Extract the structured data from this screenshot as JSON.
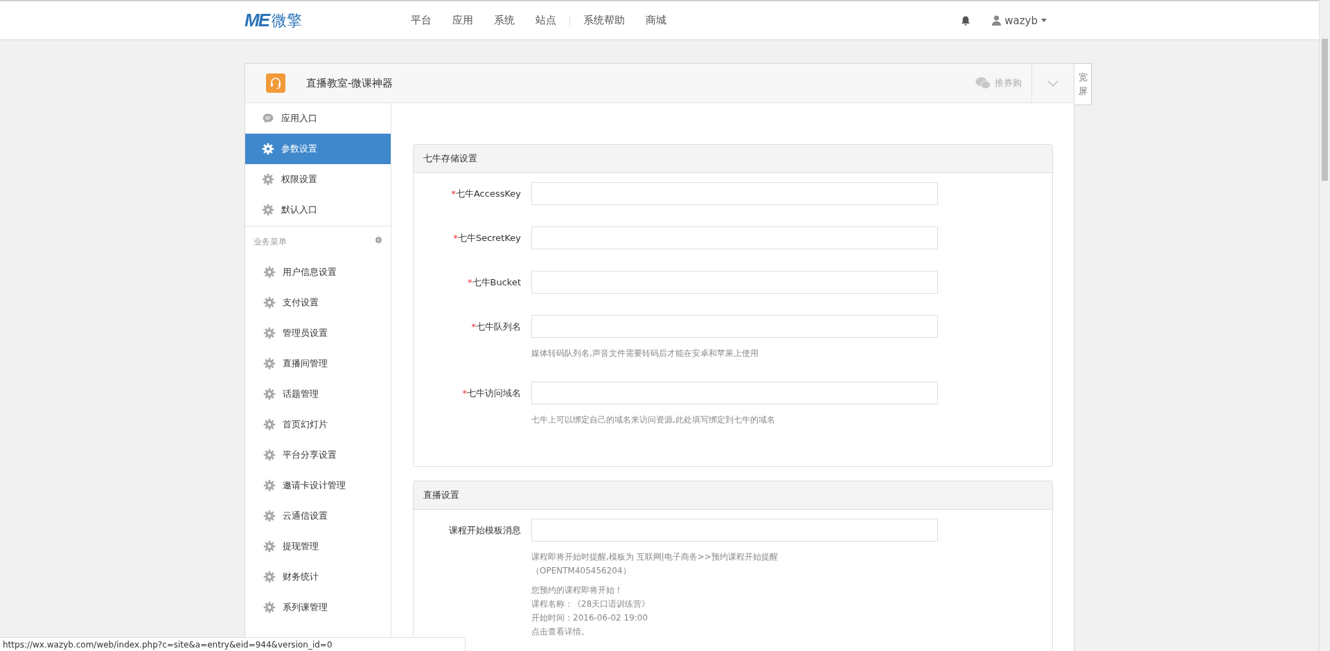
{
  "navbar": {
    "logo": {
      "mark": "ME",
      "text": "微擎"
    },
    "menu": [
      {
        "label": "平台",
        "divider_before": false
      },
      {
        "label": "应用",
        "divider_before": false
      },
      {
        "label": "系统",
        "divider_before": false
      },
      {
        "label": "站点",
        "divider_before": false
      },
      {
        "label": "系统帮助",
        "divider_before": true
      },
      {
        "label": "商城",
        "divider_before": false
      }
    ],
    "user": {
      "name": "wazyb"
    }
  },
  "module": {
    "title": "直播教室-微课神器",
    "share_label": "推券购"
  },
  "wide_toggle": "宽屏",
  "sidebar": {
    "items": [
      {
        "label": "应用入口",
        "kind": "chat",
        "selected": false
      },
      {
        "label": "参数设置",
        "kind": "gear",
        "selected": true
      },
      {
        "label": "权限设置",
        "kind": "gear",
        "selected": false
      },
      {
        "label": "默认入口",
        "kind": "gear",
        "selected": false
      }
    ],
    "group": {
      "title": "业务菜单",
      "items": [
        {
          "label": "用户信息设置",
          "kind": "gear",
          "selected": false
        },
        {
          "label": "支付设置",
          "kind": "gear",
          "selected": false
        },
        {
          "label": "管理员设置",
          "kind": "gear",
          "selected": false
        },
        {
          "label": "直播间管理",
          "kind": "gear",
          "selected": false
        },
        {
          "label": "话题管理",
          "kind": "gear",
          "selected": false
        },
        {
          "label": "首页幻灯片",
          "kind": "gear",
          "selected": false
        },
        {
          "label": "平台分享设置",
          "kind": "gear",
          "selected": false
        },
        {
          "label": "邀请卡设计管理",
          "kind": "gear",
          "selected": false
        },
        {
          "label": "云通信设置",
          "kind": "gear",
          "selected": false
        },
        {
          "label": "提现管理",
          "kind": "gear",
          "selected": false
        },
        {
          "label": "财务统计",
          "kind": "gear",
          "selected": false
        },
        {
          "label": "系列课管理",
          "kind": "gear",
          "selected": false
        }
      ]
    }
  },
  "panels": [
    {
      "title": "七牛存储设置",
      "fields": [
        {
          "label": "七牛AccessKey",
          "required_mark": "*"
        },
        {
          "label": "七牛SecretKey",
          "required_mark": "*"
        },
        {
          "label": "七牛Bucket",
          "required_mark": "*"
        },
        {
          "label": "七牛队列名",
          "required_mark": "*",
          "help": [
            [
              "媒体转码队列名,声音文件需要转码后才能在安卓和苹果上使用"
            ]
          ]
        },
        {
          "label": "七牛访问域名",
          "required_mark": "*",
          "help": [
            [
              "七牛上可以绑定自己的域名来访问资源,此处填写绑定到七牛的域名"
            ]
          ]
        }
      ]
    },
    {
      "title": "直播设置",
      "fields": [
        {
          "label": "课程开始模板消息",
          "help": [
            [
              "课程即将开始时提醒,模板为 互联网|电子商务>>预约课程开始提醒",
              "（OPENTM405456204）"
            ],
            [
              "您预约的课程即将开始！",
              "课程名称：《28天口语训练营》",
              "开始时间：2016-06-02 19:00",
              "点击查看详情。"
            ]
          ]
        }
      ]
    }
  ],
  "status_bar": {
    "url": "https://wx.wazyb.com/web/index.php?c=site&a=entry&eid=944&version_id=0"
  }
}
